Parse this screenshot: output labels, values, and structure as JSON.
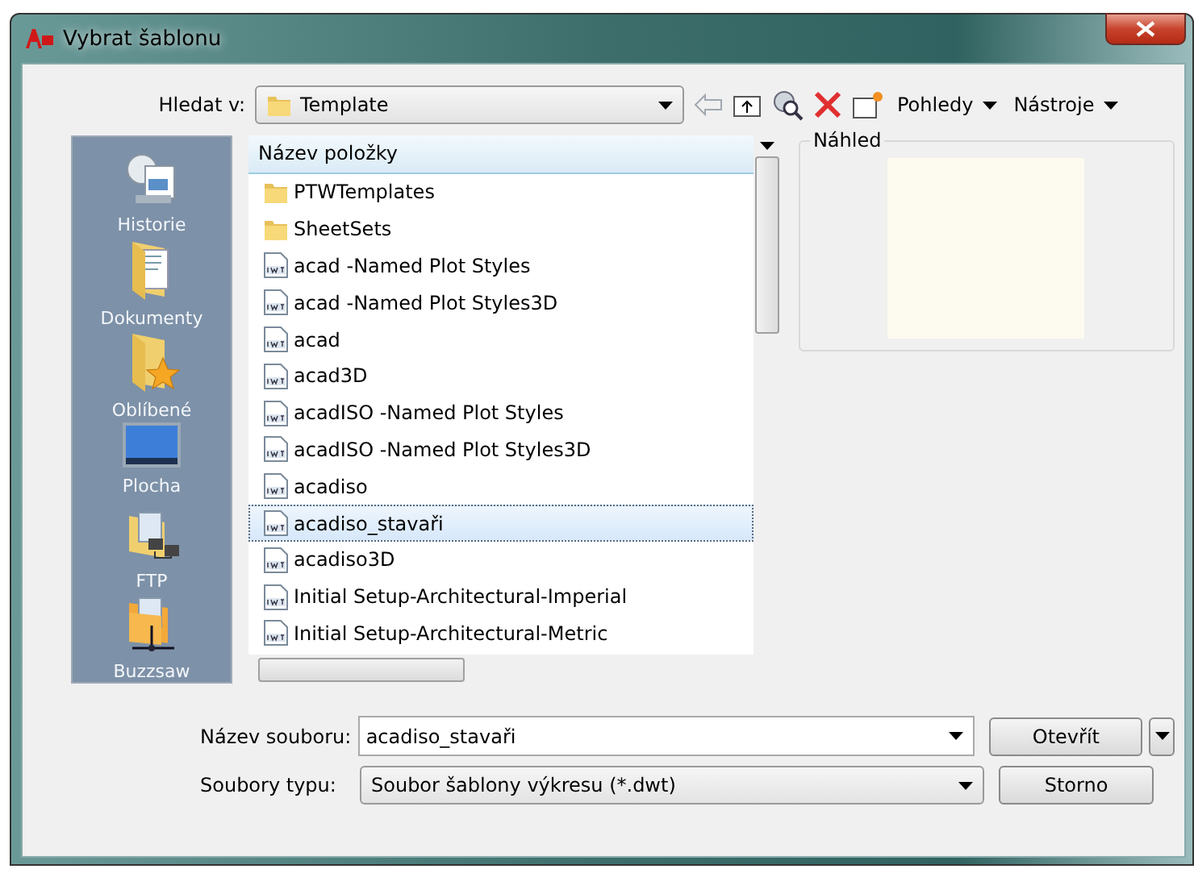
{
  "window": {
    "title": "Vybrat šablonu"
  },
  "toolbar": {
    "look_in_label": "Hledat v:",
    "look_in_value": "Template",
    "views": "Pohledy",
    "tools": "Nástroje"
  },
  "places": [
    {
      "label": "Historie",
      "kind": "history"
    },
    {
      "label": "Dokumenty",
      "kind": "documents"
    },
    {
      "label": "Oblíbené",
      "kind": "favorites"
    },
    {
      "label": "Plocha",
      "kind": "desktop"
    },
    {
      "label": "FTP",
      "kind": "ftp"
    },
    {
      "label": "Buzzsaw",
      "kind": "buzzsaw"
    }
  ],
  "file_list": {
    "column": "Název položky",
    "items": [
      {
        "name": "PTWTemplates",
        "kind": "folder",
        "selected": false
      },
      {
        "name": "SheetSets",
        "kind": "folder",
        "selected": false
      },
      {
        "name": "acad -Named Plot Styles",
        "kind": "dwt",
        "selected": false
      },
      {
        "name": "acad -Named Plot Styles3D",
        "kind": "dwt",
        "selected": false
      },
      {
        "name": "acad",
        "kind": "dwt",
        "selected": false
      },
      {
        "name": "acad3D",
        "kind": "dwt",
        "selected": false
      },
      {
        "name": "acadISO -Named Plot Styles",
        "kind": "dwt",
        "selected": false
      },
      {
        "name": "acadISO -Named Plot Styles3D",
        "kind": "dwt",
        "selected": false
      },
      {
        "name": "acadiso",
        "kind": "dwt",
        "selected": false
      },
      {
        "name": "acadiso_stavaři",
        "kind": "dwt",
        "selected": true
      },
      {
        "name": "acadiso3D",
        "kind": "dwt",
        "selected": false
      },
      {
        "name": "Initial Setup-Architectural-Imperial",
        "kind": "dwt",
        "selected": false
      },
      {
        "name": "Initial Setup-Architectural-Metric",
        "kind": "dwt",
        "selected": false
      }
    ]
  },
  "preview": {
    "title": "Náhled"
  },
  "file_name": {
    "label": "Název souboru:",
    "value": "acadiso_stavaři"
  },
  "file_type": {
    "label": "Soubory typu:",
    "value": "Soubor šablony výkresu (*.dwt)"
  },
  "buttons": {
    "open": "Otevřít",
    "cancel": "Storno"
  }
}
